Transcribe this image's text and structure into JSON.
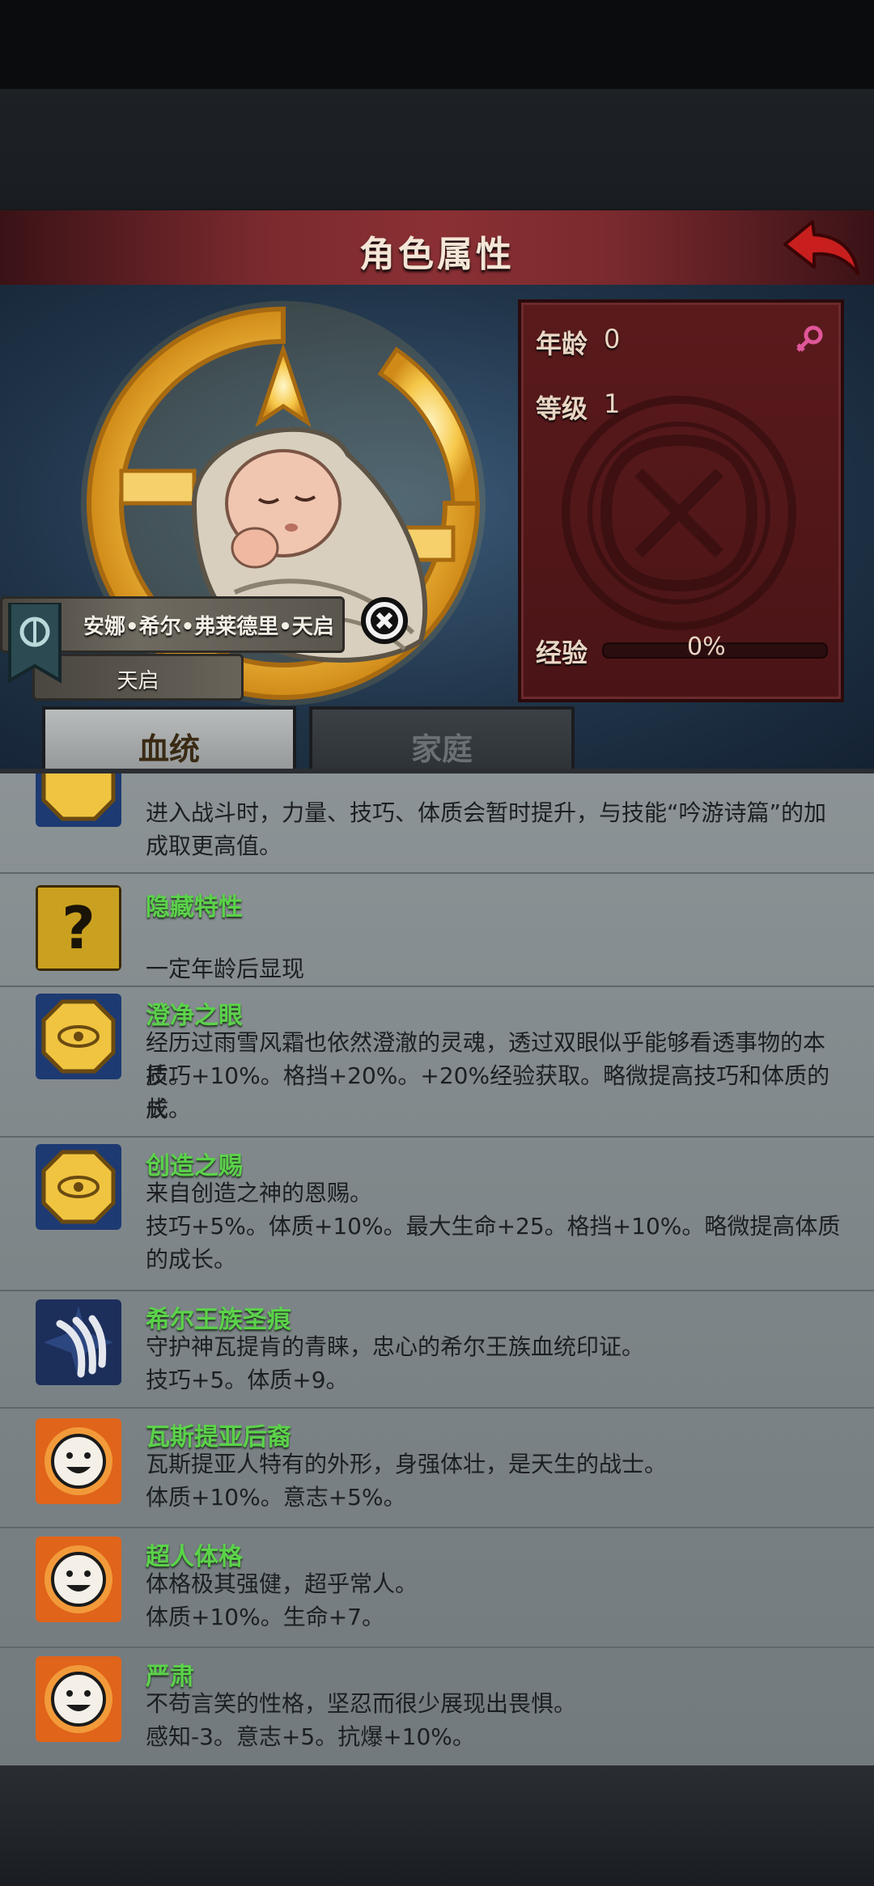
{
  "header": {
    "title": "角色属性"
  },
  "stats": {
    "age_label": "年龄",
    "age_value": "0",
    "level_label": "等级",
    "level_value": "1",
    "exp_label": "经验",
    "exp_value": "0%",
    "exp_progress": 0
  },
  "character": {
    "name": "安娜•希尔•弗莱德里•天启",
    "title": "天启"
  },
  "tabs": [
    {
      "label": "血统"
    },
    {
      "label": "家庭"
    }
  ],
  "traits": [
    {
      "name": "",
      "icon": "gold-octagon-icon",
      "lines": [
        "进入战斗时，力量、技巧、体质会暂时提升，与技能“吟游诗篇”的加",
        "成取更高值。"
      ]
    },
    {
      "name": "隐藏特性",
      "icon": "question-mark-icon",
      "lines": [
        "",
        "一定年龄后显现"
      ]
    },
    {
      "name": "澄净之眼",
      "icon": "gold-eye-icon",
      "lines": [
        "经历过雨雪风霜也依然澄澈的灵魂，透过双眼似乎能够看透事物的本质。",
        "技巧+10%。格挡+20%。+20%经验获取。略微提高技巧和体质的成",
        "长。"
      ]
    },
    {
      "name": "创造之赐",
      "icon": "gold-eye-icon",
      "lines": [
        "来自创造之神的恩赐。",
        "技巧+5%。体质+10%。最大生命+25。格挡+10%。略微提高体质",
        "的成长。"
      ]
    },
    {
      "name": "希尔王族圣痕",
      "icon": "claw-icon",
      "lines": [
        "守护神瓦提肯的青睐，忠心的希尔王族血统印证。",
        "技巧+5。体质+9。"
      ]
    },
    {
      "name": "瓦斯提亚后裔",
      "icon": "smiley-icon",
      "lines": [
        "瓦斯提亚人特有的外形，身强体壮，是天生的战士。",
        "体质+10%。意志+5%。"
      ]
    },
    {
      "name": "超人体格",
      "icon": "smiley-icon",
      "lines": [
        "体格极其强健，超乎常人。",
        "体质+10%。生命+7。"
      ]
    },
    {
      "name": "严肃",
      "icon": "smiley-icon",
      "lines": [
        "不苟言笑的性格，坚忍而很少展现出畏惧。",
        "感知-3。意志+5。抗爆+10%。"
      ]
    }
  ]
}
